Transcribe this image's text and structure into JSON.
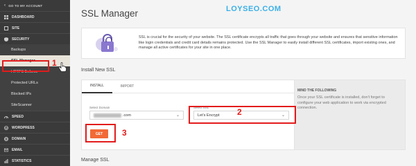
{
  "sidebar": {
    "top_link": "GO TO MY ACCOUNT",
    "sections": [
      {
        "label": "DASHBOARD",
        "icon": "dashboard-icon"
      },
      {
        "label": "SITE",
        "icon": "site-icon"
      },
      {
        "label": "SECURITY",
        "icon": "security-icon"
      }
    ],
    "security_items": [
      "Backups",
      "SSL Manager",
      "HTTPS Enforce",
      "Protected URLs",
      "Blocked IPs",
      "SiteScanner"
    ],
    "active_item": "SSL Manager",
    "lower_sections": [
      {
        "label": "SPEED",
        "icon": "speed-icon"
      },
      {
        "label": "WORDPRESS",
        "icon": "wordpress-icon"
      },
      {
        "label": "DOMAIN",
        "icon": "domain-icon"
      },
      {
        "label": "EMAIL",
        "icon": "email-icon"
      },
      {
        "label": "STATISTICS",
        "icon": "statistics-icon"
      }
    ]
  },
  "page": {
    "title": "SSL Manager",
    "watermark": "LOYSEO.COM",
    "info_text": "SSL is crucial for the security of your website. The SSL certificate encrypts all traffic that goes through your website and ensures that sensitive information like login credentials and credit card details remains protected. Use the SSL Manager to easily install different SSL certificates, import existing ones, and manage all active certificates for your site in one place.",
    "install_heading": "Install New SSL",
    "manage_heading": "Manage SSL"
  },
  "install": {
    "tabs": [
      "INSTALL",
      "IMPORT"
    ],
    "active_tab": "INSTALL",
    "domain_label": "Select Domain",
    "domain_value": ".com",
    "ssl_label": "Select SSL",
    "ssl_value": "Let's Encrypt",
    "get_button": "GET"
  },
  "mind": {
    "title": "MIND THE FOLLOWING",
    "text": "Once your SSL certificate is installed, don't forget to configure your web application to work via encrypted connection."
  },
  "annotations": {
    "step1": "1",
    "step2": "2",
    "step3": "3",
    "color": "#e31b1b"
  },
  "colors": {
    "sidebar_bg": "#3a3a3a",
    "accent_orange": "#f26a36",
    "watermark_blue": "#3ab0e8"
  }
}
